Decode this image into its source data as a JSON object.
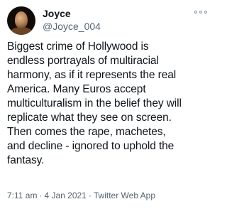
{
  "user": {
    "display_name": "Joyce",
    "handle": "@Joyce_004"
  },
  "tweet": {
    "text": "Biggest crime of Hollywood is\nendless portrayals of multiracial\nharmony, as if it represents the real\nAmerica. Many Euros accept\nmulticulturalism in the belief they will\nreplicate what they see on screen.\nThen comes the rape, machetes,\nand decline - ignored to uphold the\nfantasy.",
    "time": "7:11 am",
    "date": "4 Jan 2021",
    "source": "Twitter Web App",
    "separator": "·"
  },
  "icons": {
    "more": "more-options-icon"
  }
}
